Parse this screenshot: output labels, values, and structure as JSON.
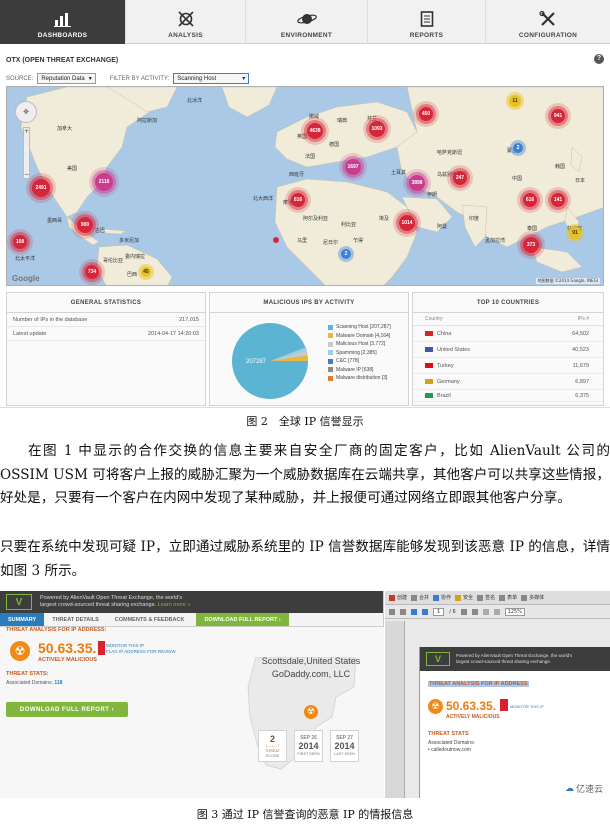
{
  "figure2": {
    "nav_tabs": [
      {
        "label": "DASHBOARDS",
        "icon": "bar-chart-icon"
      },
      {
        "label": "ANALYSIS",
        "icon": "crosshair-icon"
      },
      {
        "label": "ENVIRONMENT",
        "icon": "planet-icon"
      },
      {
        "label": "REPORTS",
        "icon": "document-icon"
      },
      {
        "label": "CONFIGURATION",
        "icon": "tools-icon"
      }
    ],
    "otx_title": "OTX (OPEN THREAT EXCHANGE)",
    "help": "?",
    "source_label": "SOURCE:",
    "source_value": "Reputation Data",
    "filter_label": "FILTER BY ACTIVITY:",
    "filter_value": "Scanning Host",
    "map": {
      "clusters": [
        "2491",
        "2116",
        "4638",
        "1093",
        "450",
        "11",
        "941",
        "2",
        "1697",
        "3898",
        "247",
        "616",
        "141",
        "816",
        "900",
        "108",
        "1014",
        "2",
        "373",
        "91",
        "734",
        "45"
      ],
      "labels": [
        "北太平洋",
        "北大西洋",
        "北冰洋",
        "巴西",
        "中国",
        "阿尔及利亚",
        "利比亚",
        "埃及",
        "蒙古",
        "印度",
        "伊朗",
        "马里",
        "尼日尔",
        "乍得",
        "阿曼",
        "泰国",
        "菲律宾",
        "委内瑞拉",
        "哥伦比亚",
        "墨西哥",
        "古巴",
        "多米尼加",
        "摩洛哥",
        "西班牙",
        "法国",
        "德国",
        "英国",
        "瑞典",
        "芬兰",
        "挪威",
        "加拿大",
        "美国",
        "阿拉斯加",
        "日本",
        "韩国",
        "土耳其",
        "哈萨克斯坦",
        "乌兹别克斯坦",
        "孟加拉湾"
      ],
      "google": "Google",
      "attribution": "地图数据 ©2014 Google, INEGI"
    },
    "general_statistics": {
      "title": "GENERAL STATISTICS",
      "rows": [
        {
          "label": "Number of IPs in the database",
          "value": "217,015"
        },
        {
          "label": "Latest update",
          "value": "2014-04-17 14:20:03"
        }
      ]
    },
    "malicious_by_activity": {
      "title": "MALICIOUS IPS BY ACTIVITY",
      "pie_label": "207287",
      "legend": [
        {
          "label": "Scanning Host [207,287]",
          "color": "#5bb4d2"
        },
        {
          "label": "Malware Domain [4,164]",
          "color": "#e8b93a"
        },
        {
          "label": "Malicious Host [3,772]",
          "color": "#c9c9c9"
        },
        {
          "label": "Spamming [2,385]",
          "color": "#9ad0e2"
        },
        {
          "label": "C&C [778]",
          "color": "#3f7fbf"
        },
        {
          "label": "Malware IP [638]",
          "color": "#8a8a8a"
        },
        {
          "label": "Malware distribution [3]",
          "color": "#e07c2a"
        }
      ]
    },
    "top_countries": {
      "title": "TOP 10 COUNTRIES",
      "col_country": "Country",
      "col_ips": "IPs #",
      "rows": [
        {
          "name": "China",
          "ips": "64,502",
          "flag": "#d8232a"
        },
        {
          "name": "United States",
          "ips": "40,523",
          "flag": "#3c5aa6"
        },
        {
          "name": "Turkey",
          "ips": "11,679",
          "flag": "#e30a17"
        },
        {
          "name": "Germany",
          "ips": "6,897",
          "flag": "#d4a017"
        },
        {
          "name": "Brazil",
          "ips": "6,375",
          "flag": "#229e45"
        }
      ]
    }
  },
  "caption2": "图 2　全球 IP 信誉显示",
  "paragraph1": "在图 1 中显示的合作交换的信息主要来自安全厂商的固定客户，比如 AlienVault 公司的 OSSIM USM 可将客户上报的威胁汇聚为一个威胁数据库在云端共享，其他客户可以共享这些情报，好处是，只要有一个客户在内网中发现了某种威胁，并上报便可通过网络立即跟其他客户分享。",
  "paragraph2": "只要在系统中发现可疑 IP，立即通过威胁系统里的 IP 信誉数据库能够发现到该恶意 IP 的信息，详情如图 3 所示。",
  "figure3": {
    "logo": "V",
    "tagline_1": "Powered by AlienVault Open Threat Exchange, the world's",
    "tagline_2": "largest crowd-sourced threat sharing exchange.",
    "learn_more": "Learn more »",
    "tabs": [
      "SUMMARY",
      "THREAT DETAILS",
      "COMMENTS & FEEDBACK",
      "DOWNLOAD FULL REPORT ›"
    ],
    "threat_analysis_label": "THREAT ANALYSIS FOR IP ADDRESS:",
    "ip": "50.63.35.",
    "monitor": "MONITOR THIS IP",
    "flag_review": "FLAG IP ADDRESS FOR REVIEW",
    "actively_malicious": "ACTIVELY MALICIOUS",
    "threat_stats_label": "THREAT STATS:",
    "associated_domains_label": "Associated Domains:",
    "associated_domains_value": "118",
    "download_button": "DOWNLOAD FULL REPORT ›",
    "location": "Scottsdale,United States",
    "isp": "GoDaddy.com, LLC",
    "stats": [
      {
        "top": "SEP 26",
        "value": "2014",
        "label": "FIRST SEEN"
      },
      {
        "top": "SEP 27",
        "value": "2014",
        "label": "LAST SEEN"
      }
    ],
    "threat_score": {
      "value": "2",
      "scale_min": "1",
      "scale_max": "7",
      "label": "THREAT SCORE"
    },
    "acrobat_toolbar_1": [
      "创建",
      "合并",
      "协作",
      "安全",
      "签名",
      "表单",
      "多媒体"
    ],
    "acrobat_page": "1",
    "acrobat_pages": "/ 6",
    "acrobat_zoom": "125%",
    "doc_threat_label": "THREAT ANALYSIS FOR IP ADDRESS",
    "doc_ip": "50.63.35.",
    "doc_monitor": "MONITOR THIS IP",
    "doc_am": "ACTIVELY MALICIOUS",
    "doc_threat_stats": "THREAT STATS",
    "doc_associated": "Associated Domains:",
    "doc_domain": "• calledoutnow.com",
    "watermark": "亿速云"
  },
  "caption3": "图 3  通过 IP 信誉查询的恶意 IP 的情报信息"
}
